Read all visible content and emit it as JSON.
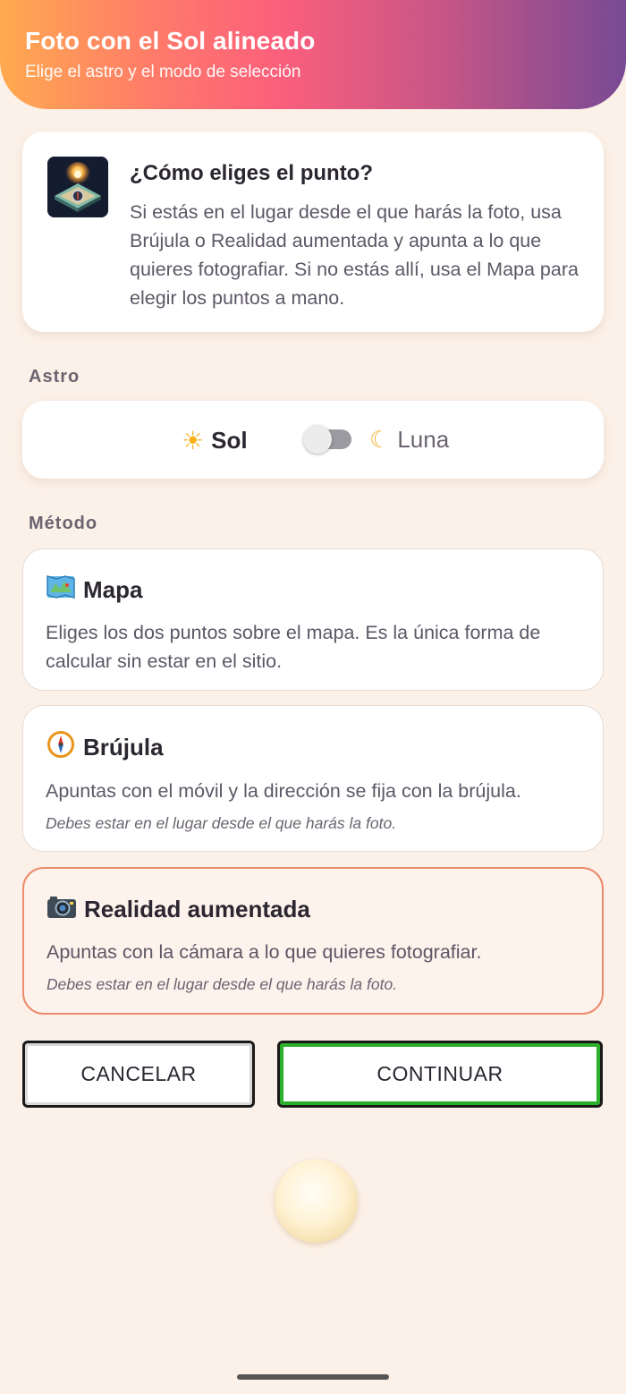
{
  "header": {
    "title": "Foto con el Sol alineado",
    "subtitle": "Elige el astro y el modo de selección"
  },
  "info": {
    "title": "¿Cómo eliges el punto?",
    "body": "Si estás en el lugar desde el que harás la foto, usa Brújula o Realidad aumentada y apunta a lo que quieres fotografiar. Si no estás allí, usa el Mapa para elegir los puntos a mano."
  },
  "astro": {
    "section_label": "Astro",
    "sun_label": "Sol",
    "moon_label": "Luna",
    "toggle_state": "sol"
  },
  "method": {
    "section_label": "Método",
    "options": [
      {
        "icon": "map-icon",
        "title": "Mapa",
        "description": "Eliges los dos puntos sobre el mapa. Es la única forma de calcular sin estar en el sitio.",
        "note": "",
        "selected": false
      },
      {
        "icon": "compass-icon",
        "title": "Brújula",
        "description": "Apuntas con el móvil y la dirección se fija con la brújula.",
        "note": "Debes estar en el lugar desde el que harás la foto.",
        "selected": false
      },
      {
        "icon": "camera-icon",
        "title": "Realidad aumentada",
        "description": "Apuntas con la cámara a lo que quieres fotografiar.",
        "note": "Debes estar en el lugar desde el que harás la foto.",
        "selected": true
      }
    ]
  },
  "buttons": {
    "cancel": "CANCELAR",
    "continue": "CONTINUAR"
  },
  "colors": {
    "background": "#fcf1e8",
    "selected_border": "#ec8a6d",
    "continue_highlight": "#2bb02b",
    "header_gradient": [
      "#ffaa4f",
      "#fb5f7c",
      "#784a94"
    ]
  }
}
